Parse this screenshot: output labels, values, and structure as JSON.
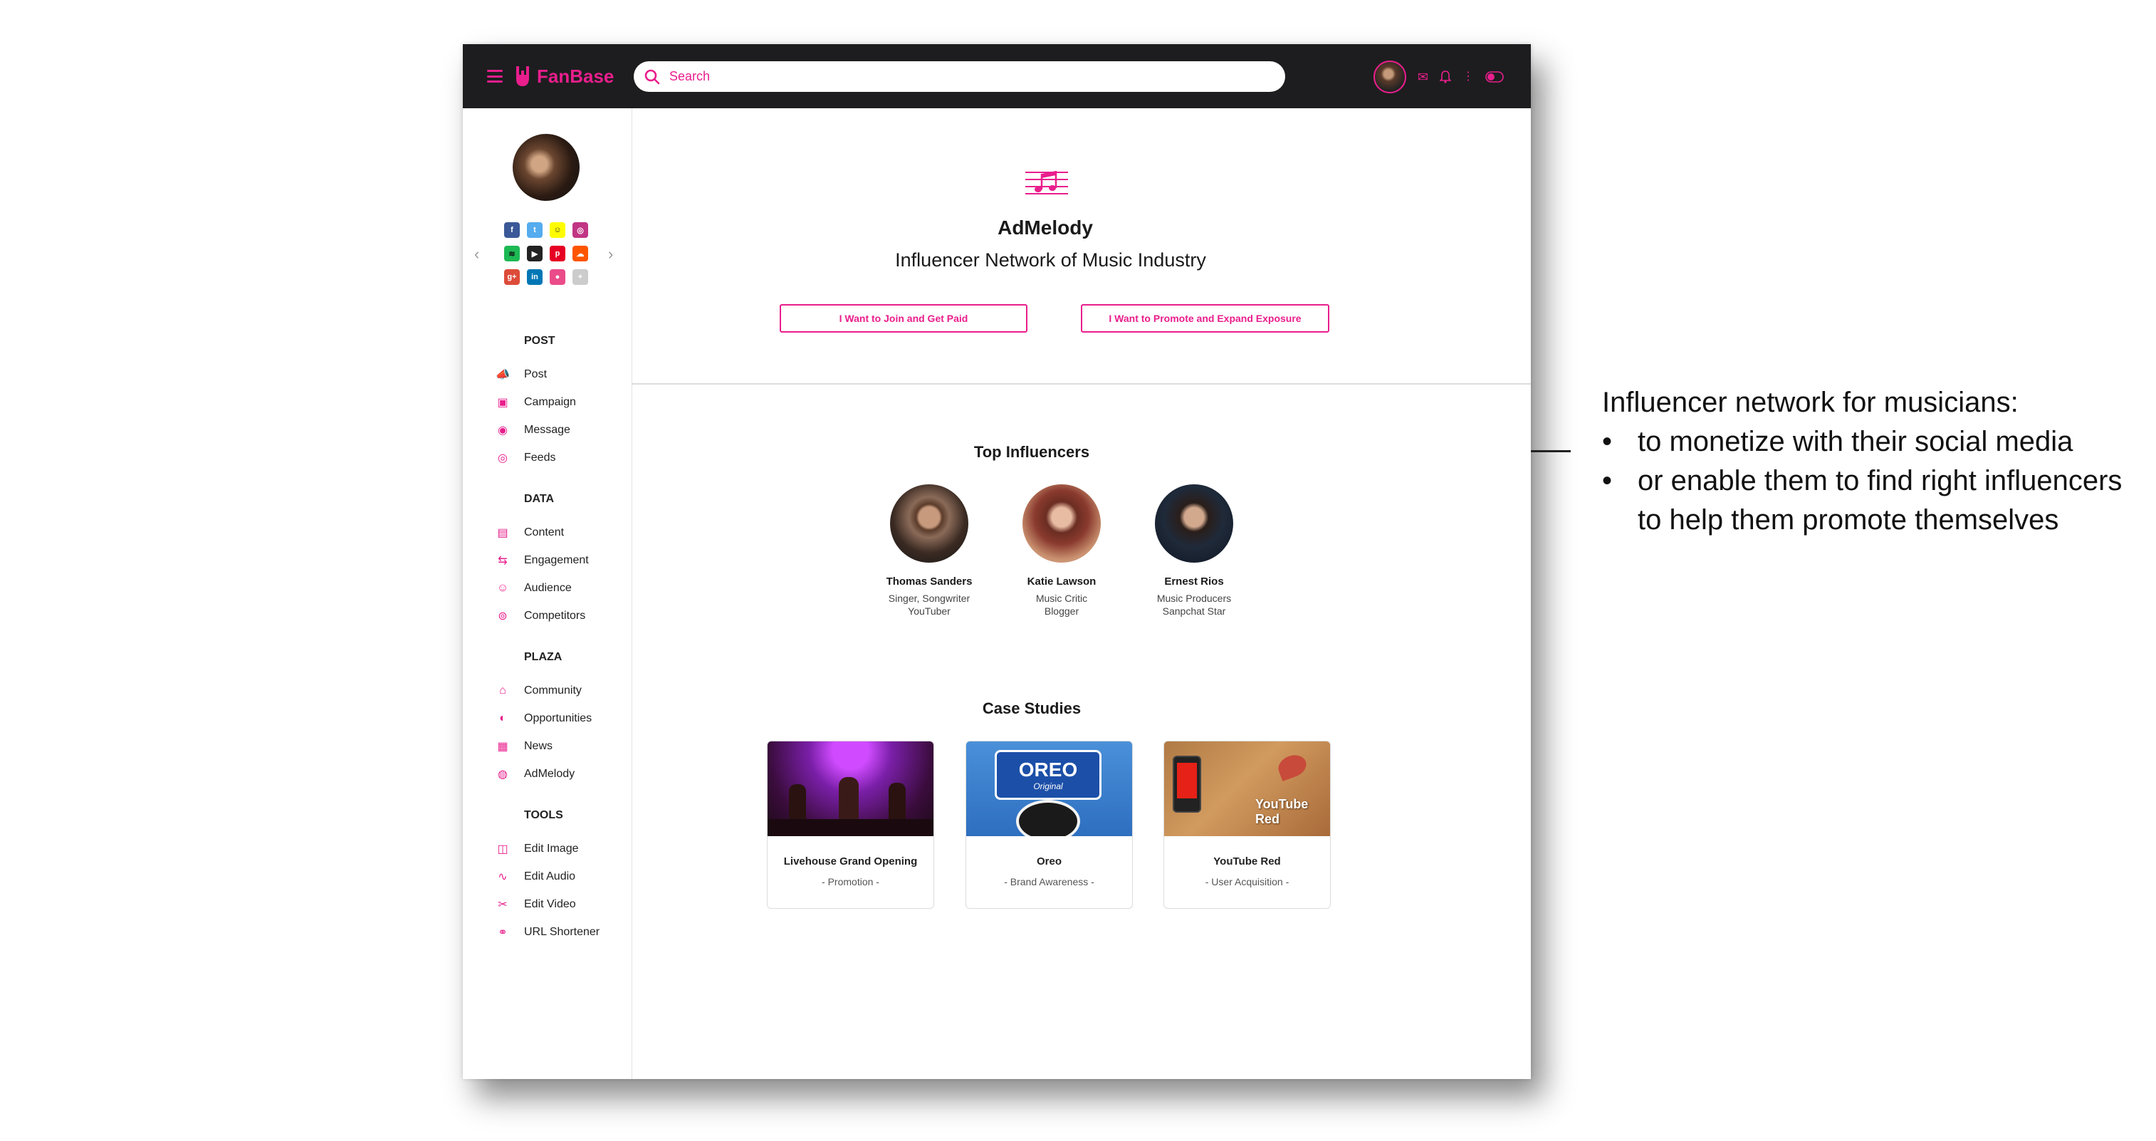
{
  "app": {
    "name": "FanBase"
  },
  "search": {
    "placeholder": "Search"
  },
  "sidebar": {
    "groups": [
      {
        "title": "POST",
        "items": [
          "Post",
          "Campaign",
          "Message",
          "Feeds"
        ]
      },
      {
        "title": "DATA",
        "items": [
          "Content",
          "Engagement",
          "Audience",
          "Competitors"
        ]
      },
      {
        "title": "PLAZA",
        "items": [
          "Community",
          "Opportunities",
          "News",
          "AdMelody"
        ]
      },
      {
        "title": "TOOLS",
        "items": [
          "Edit Image",
          "Edit Audio",
          "Edit Video",
          "URL Shortener"
        ]
      }
    ]
  },
  "hero": {
    "title": "AdMelody",
    "subtitle": "Influencer Network of Music Industry",
    "join_button": "I Want to Join and Get Paid",
    "promote_button": "I Want to Promote and Expand Exposure"
  },
  "influencers": {
    "title": "Top Influencers",
    "items": [
      {
        "name": "Thomas Sanders",
        "role1": "Singer, Songwriter",
        "role2": "YouTuber"
      },
      {
        "name": "Katie Lawson",
        "role1": "Music Critic",
        "role2": "Blogger"
      },
      {
        "name": "Ernest Rios",
        "role1": "Music Producers",
        "role2": "Sanpchat Star"
      }
    ]
  },
  "cases": {
    "title": "Case Studies",
    "items": [
      {
        "title": "Livehouse Grand Opening",
        "subtitle": "- Promotion -"
      },
      {
        "title": "Oreo",
        "subtitle": "- Brand Awareness -",
        "image_text1": "OREO",
        "image_text2": "Original"
      },
      {
        "title": "YouTube Red",
        "subtitle": "- User Acquisition -",
        "image_text": "YouTube Red"
      }
    ]
  },
  "annotation": {
    "heading": "Influencer network for musicians:",
    "bullet1": "to monetize with their social media",
    "bullet2": "or enable them to find right influencers",
    "bullet2_cont": "to help them promote themselves"
  },
  "colors": {
    "accent": "#e91e8c",
    "topbar": "#1d1d1f"
  }
}
